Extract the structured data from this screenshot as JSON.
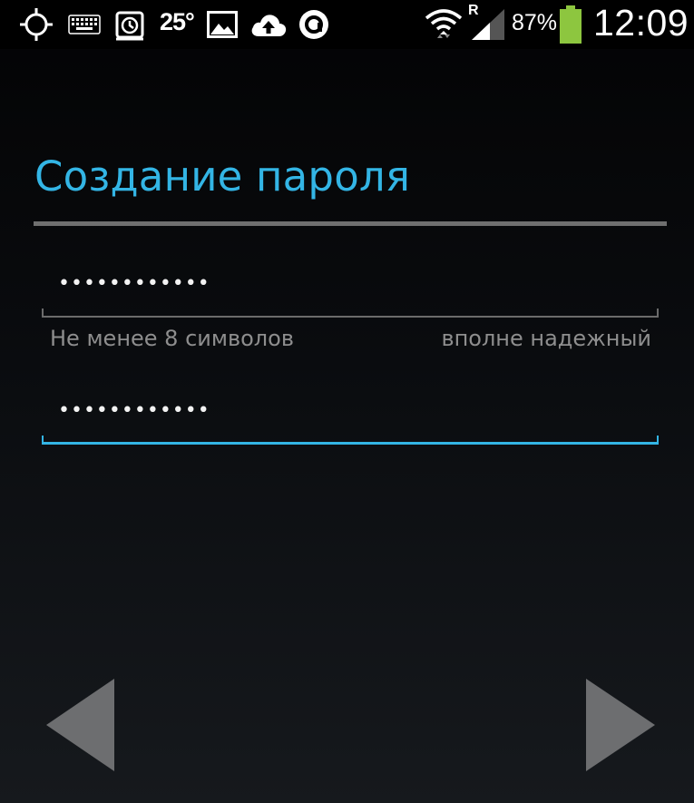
{
  "status_bar": {
    "icons": [
      "gps-icon",
      "keyboard-icon",
      "alarm-icon",
      "image-icon",
      "cloud-upload-icon",
      "app-circle-icon",
      "wifi-icon",
      "signal-icon",
      "battery-icon"
    ],
    "temperature": "25°",
    "roaming": "R",
    "battery_percent": "87%",
    "clock": "12:09",
    "battery_color": "#8dc63f"
  },
  "screen": {
    "title": "Создание пароля",
    "accent_color": "#33b5e5"
  },
  "password": {
    "value": "••••••••••••",
    "hint_min_length": "Не менее 8 символов",
    "strength": "вполне надежный"
  },
  "confirm_password": {
    "value": "••••••••••••"
  },
  "navigation": {
    "back_icon": "arrow-left-icon",
    "next_icon": "arrow-right-icon"
  }
}
